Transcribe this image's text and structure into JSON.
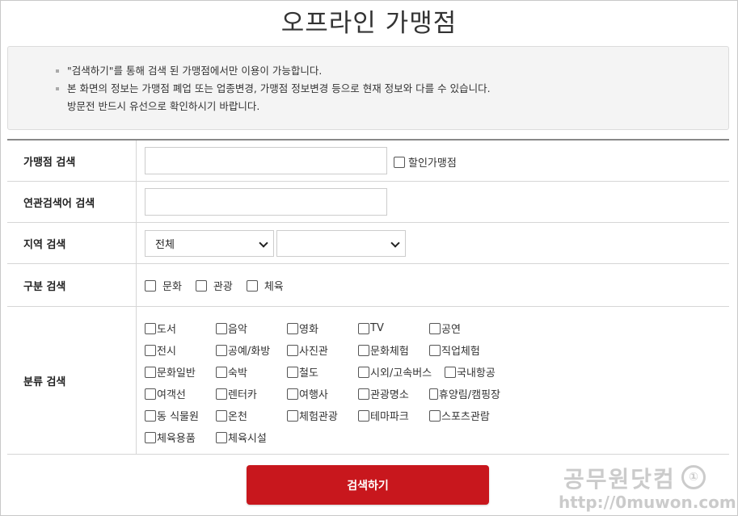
{
  "page": {
    "title": "오프라인 가맹점"
  },
  "notice": {
    "lines": [
      "\"검색하기\"를 통해 검색 된 가맹점에서만 이용이 가능합니다.",
      "본 화면의 정보는 가맹점 폐업 또는 업종변경, 가맹점 정보변경 등으로 현재 정보와 다를 수 있습니다.",
      "방문전 반드시 유선으로 확인하시기 바랍니다."
    ]
  },
  "form": {
    "store_search": {
      "label": "가맹점 검색",
      "value": "",
      "discount_label": "할인가맹점"
    },
    "keyword_search": {
      "label": "연관검색어 검색",
      "value": ""
    },
    "region_search": {
      "label": "지역 검색",
      "primary": "전체",
      "secondary": ""
    },
    "type_search": {
      "label": "구분 검색",
      "options": [
        "문화",
        "관광",
        "체육"
      ]
    },
    "category_search": {
      "label": "분류 검색",
      "rows": [
        [
          "도서",
          "음악",
          "영화",
          "TV",
          "공연"
        ],
        [
          "전시",
          "공예/화방",
          "사진관",
          "문화체험",
          "직업체험"
        ],
        [
          "문화일반",
          "숙박",
          "철도",
          "시외/고속버스",
          "국내항공"
        ],
        [
          "여객선",
          "렌터카",
          "여행사",
          "관광명소",
          "휴양림/캠핑장"
        ],
        [
          "동 식물원",
          "온천",
          "체험관광",
          "테마파크",
          "스포츠관람"
        ],
        [
          "체육용품",
          "체육시설"
        ]
      ]
    }
  },
  "search_button": {
    "label": "검색하기"
  },
  "watermark": {
    "title": "공무원닷컴",
    "url": "http://0muwon.com",
    "badge": "①"
  },
  "colors": {
    "accent": "#c8171d",
    "notice_bg": "#f4f4f4"
  }
}
